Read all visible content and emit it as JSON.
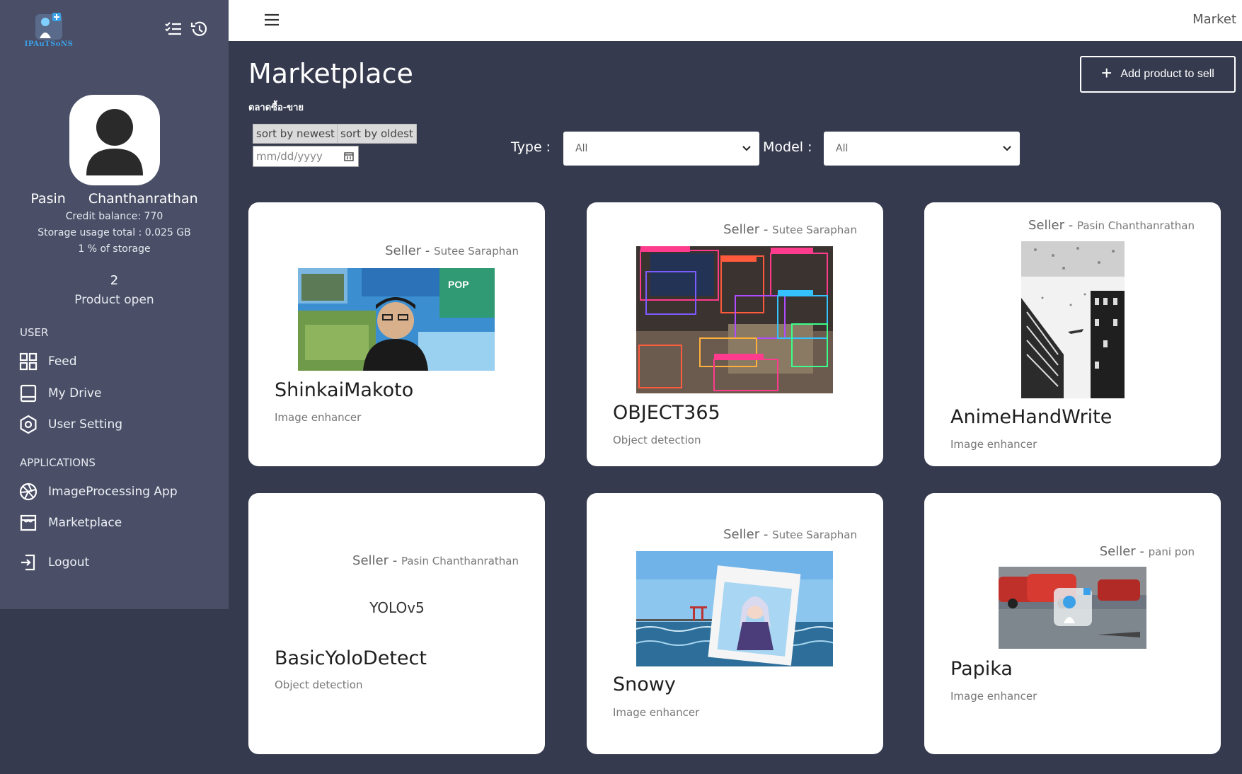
{
  "sidebar": {
    "logo_text": "IPAuTSoNS",
    "user": {
      "first_name": "Pasin",
      "last_name": "Chanthanrathan",
      "credit": "Credit balance: 770",
      "storage": "Storage usage total : 0.025 GB",
      "storage_percent": "1 % of storage"
    },
    "stats": {
      "count": "2",
      "label": "Product open"
    },
    "sections": {
      "user": "USER",
      "applications": "APPLICATIONS"
    },
    "nav": {
      "feed": "Feed",
      "my_drive": "My Drive",
      "user_setting": "User Setting",
      "image_processing": "ImageProcessing App",
      "marketplace": "Marketplace",
      "logout": "Logout"
    },
    "icons": [
      "list-check-icon",
      "history-icon",
      "grid-icon",
      "drive-icon",
      "settings-icon",
      "aperture-icon",
      "store-icon",
      "logout-icon"
    ]
  },
  "topbar": {
    "right_text": "Market"
  },
  "main": {
    "title": "Marketplace",
    "subtitle": "ตลาดซื้อ-ขาย",
    "add_button": "Add product to sell",
    "sort_newest": "sort by newest",
    "sort_oldest": "sort by oldest",
    "date_placeholder": "mm/dd/yyyy",
    "type_label": "Type :",
    "type_value": "All",
    "model_label": "Model :",
    "model_value": "All"
  },
  "cards": [
    {
      "seller_prefix": "Seller -",
      "seller": "Sutee Saraphan",
      "title": "ShinkaiMakoto",
      "type": "Image enhancer",
      "image": "collage-portrait"
    },
    {
      "seller_prefix": "Seller -",
      "seller": "Sutee Saraphan",
      "title": "OBJECT365",
      "type": "Object detection",
      "image": "detection-boxes"
    },
    {
      "seller_prefix": "Seller -",
      "seller": "Pasin Chanthanrathan",
      "title": "AnimeHandWrite",
      "type": "Image enhancer",
      "image": "sketch-city"
    },
    {
      "seller_prefix": "Seller -",
      "seller": "Pasin Chanthanrathan",
      "title": "BasicYoloDetect",
      "type": "Object detection",
      "image": "yolov5-logo",
      "logo_text": "YOLOv5"
    },
    {
      "seller_prefix": "Seller -",
      "seller": "Sutee Saraphan",
      "title": "Snowy",
      "type": "Image enhancer",
      "image": "anime-sea"
    },
    {
      "seller_prefix": "Seller -",
      "seller": "pani pon",
      "title": "Papika",
      "type": "Image enhancer",
      "image": "street-photo"
    }
  ],
  "colors": {
    "background": "#353a4e",
    "sidebar": "#4a4f67",
    "card": "#ffffff",
    "topbar": "#ffffff"
  }
}
